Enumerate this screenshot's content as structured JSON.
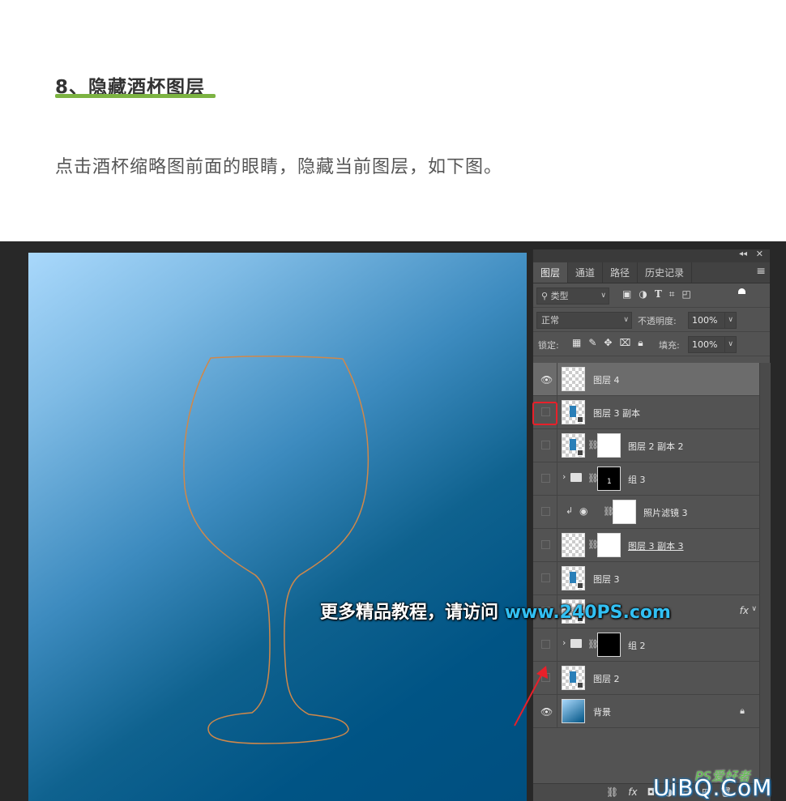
{
  "article": {
    "heading": "8、隐藏酒杯图层",
    "paragraph": "点击酒杯缩略图前面的眼睛，隐藏当前图层，如下图。"
  },
  "colors": {
    "heading_underline": "#7cb342",
    "highlight": "#e8202a",
    "watermark_url": "#32c0f3"
  },
  "panel": {
    "tabs": [
      {
        "label": "图层",
        "active": true
      },
      {
        "label": "通道",
        "active": false
      },
      {
        "label": "路径",
        "active": false
      },
      {
        "label": "历史记录",
        "active": false
      }
    ],
    "filter": {
      "label": "类型"
    },
    "blend_mode": "正常",
    "opacity": {
      "label": "不透明度:",
      "value": "100%"
    },
    "lock": {
      "label": "锁定:"
    },
    "fill": {
      "label": "填充:",
      "value": "100%"
    },
    "layers": [
      {
        "name": "图层 4",
        "visible": true,
        "selected": true
      },
      {
        "name": "图层 3 副本",
        "visible": false
      },
      {
        "name": "图层 2 副本 2",
        "visible": false
      },
      {
        "name": "组 3",
        "visible": false,
        "mask_text": "1"
      },
      {
        "name": "照片滤镜 3",
        "visible": false
      },
      {
        "name": "图层 3 副本 3",
        "visible": false
      },
      {
        "name": "图层 3",
        "visible": false
      },
      {
        "name": "",
        "visible": false,
        "fx": "fx"
      },
      {
        "name": "组 2",
        "visible": false
      },
      {
        "name": "图层 2",
        "visible": false
      },
      {
        "name": "背景",
        "visible": true,
        "locked": true
      }
    ]
  },
  "watermark": {
    "text": "更多精品教程，请访问",
    "url": "www.240PS.com"
  },
  "logo": {
    "text": "UiBQ.CoM",
    "ps_text": "PS爱好者"
  }
}
